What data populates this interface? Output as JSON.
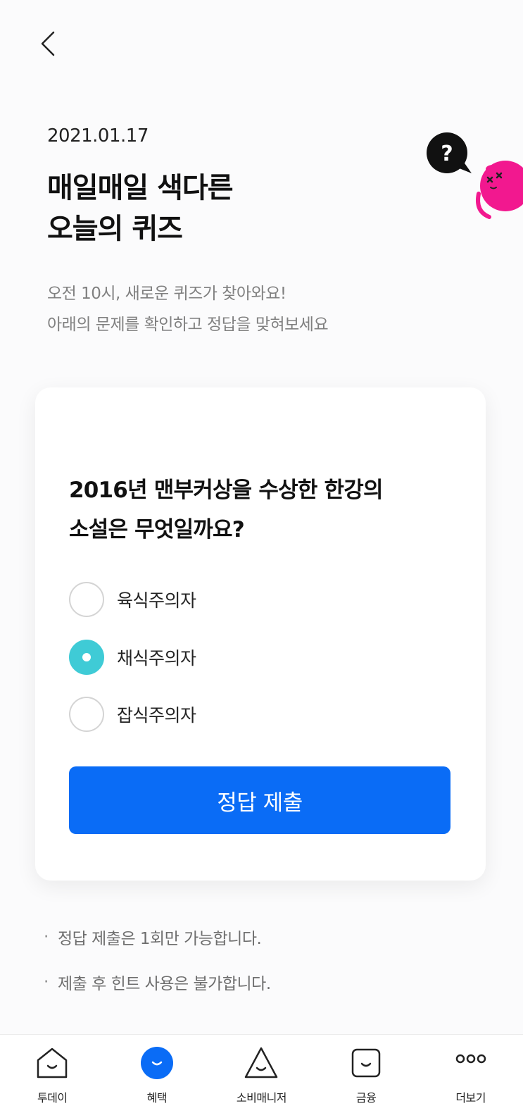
{
  "header": {
    "back_icon": "chevron-left-icon"
  },
  "quiz": {
    "date": "2021.01.17",
    "title_line1": "매일매일 색다른",
    "title_line2": "오늘의 퀴즈",
    "subtitle_line1": "오전 10시, 새로운 퀴즈가 찾아와요!",
    "subtitle_line2": "아래의 문제를 확인하고 정답을 맞혀보세요",
    "mascot": {
      "bubble_text": "?"
    }
  },
  "card": {
    "question_line1": "2016년 맨부커상을 수상한 한강의",
    "question_line2": "소설은 무엇일까요?",
    "options": [
      {
        "label": "육식주의자",
        "selected": false
      },
      {
        "label": "채식주의자",
        "selected": true
      },
      {
        "label": "잡식주의자",
        "selected": false
      }
    ],
    "submit_label": "정답 제출"
  },
  "notes": [
    "정답 제출은 1회만 가능합니다.",
    "제출 후 힌트 사용은 불가합니다."
  ],
  "tabbar": {
    "tabs": [
      {
        "label": "투데이",
        "icon": "home-smile-icon",
        "active": false
      },
      {
        "label": "혜택",
        "icon": "benefit-smile-icon",
        "active": true
      },
      {
        "label": "소비매니저",
        "icon": "triangle-smile-icon",
        "active": false
      },
      {
        "label": "금융",
        "icon": "bag-smile-icon",
        "active": false
      },
      {
        "label": "더보기",
        "icon": "more-dots-icon",
        "active": false
      }
    ]
  },
  "colors": {
    "accent_blue": "#0a6cf6",
    "radio_selected": "#3fcbd6",
    "mascot_pink": "#f2188f"
  }
}
